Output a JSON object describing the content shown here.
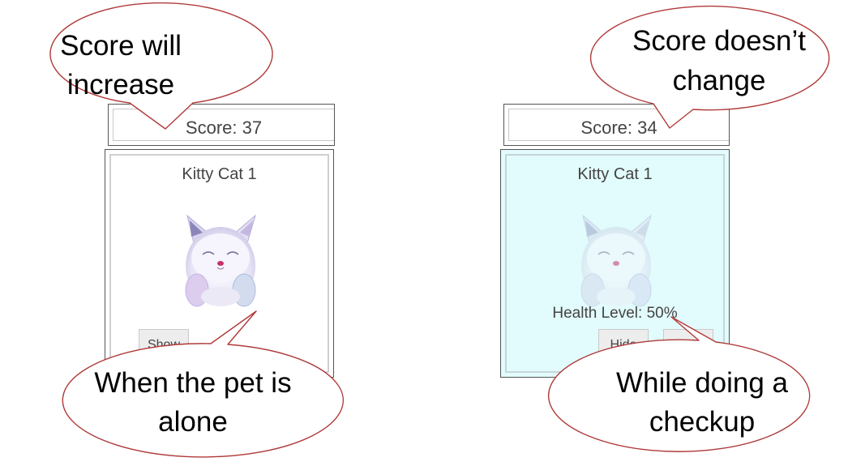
{
  "left_panel": {
    "score_text": "Score: 37",
    "pet_name": "Kitty Cat 1",
    "button_label": "Show",
    "callout_top": [
      "Score will",
      "increase"
    ],
    "callout_bottom": [
      "When the pet is",
      "alone"
    ]
  },
  "right_panel": {
    "score_text": "Score: 34",
    "pet_name": "Kitty Cat 1",
    "health_text": "Health Level: 50%",
    "hide_label": "Hide",
    "callout_top": [
      "Score doesn’t",
      "change"
    ],
    "callout_bottom": [
      "While doing a",
      "checkup"
    ]
  },
  "colors": {
    "callout_border": "#b03a3a",
    "checkup_background": "#e2fbfc"
  }
}
